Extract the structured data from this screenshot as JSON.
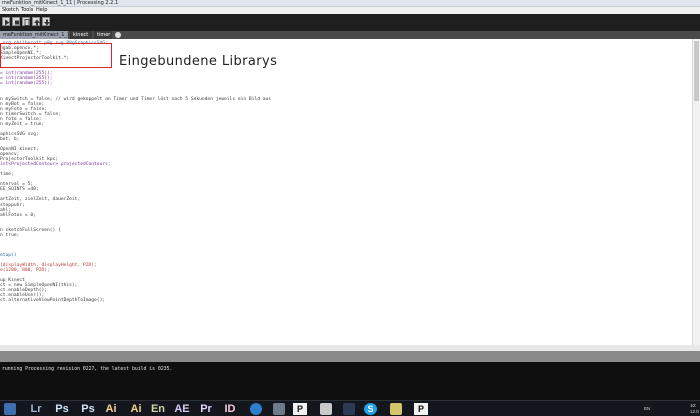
{
  "window": {
    "title": "meFunktion_mitKinect_1_11 | Processing 2.2.1"
  },
  "menu": {
    "items": [
      "Sketch",
      "Tools",
      "Help"
    ]
  },
  "tabs": [
    {
      "label": "meFunktion_mitKinect_1_11",
      "active": true
    },
    {
      "label": "kinect",
      "active": false
    },
    {
      "label": "timer",
      "active": false
    }
  ],
  "annotation": {
    "text": "Eingebundene Librarys"
  },
  "code_lines": [
    ".org.philhosoft.p8g.svg.P8gGraphicsSVG;",
    "ngab.opencv.*;",
    "SimpleOpenNI.*;",
    "KinectProjectorToolkit.*;",
    "",
    "",
    "= int(random(255));",
    "= int(random(255));",
    "= int(random(255));",
    "",
    "",
    "n mySwitch = false; // wird gekoppelt an Timer und Timer löst nach 5 Sekunden jeweils ein Bild aus",
    "n myBot = false;",
    "n myFoto = false;",
    "n timerSwitch = false;",
    "n foto = false;",
    "n myZeit = true;",
    "",
    "aphicsSVG svg;",
    "bot, b;",
    "",
    "OpenNI kinect;",
    "opencv;",
    "ProjectorToolkit kpc;",
    "ist<ProjectedContour> projectedContours;",
    "",
    "time;",
    "",
    "nterval = 5;",
    "EE_SOINTS =40;",
    "",
    "artZeit, zielZeit, dauerZeit;",
    "stoppuhr;",
    "ahl;",
    "ahlFotos = 0;",
    "",
    "",
    "n sketchFullScreen() {",
    "n true;",
    "",
    "",
    "",
    "etup()",
    "",
    "(displayWidth, displayHeight, P2D);",
    "e(1280, 800, P2D);",
    "",
    "up Kinect",
    "ct = new SimpleOpenNI(this);",
    "ct.enableDepth();",
    "ct.enableUser();",
    "ct.alternativeViewPointDepthToImage();",
    ""
  ],
  "console": {
    "message": "running Processing revision 0227, the latest build is 0235."
  },
  "taskbar": {
    "apps": [
      "Lr",
      "Ps",
      "Ps",
      "Ai",
      "Ai",
      "En",
      "AE",
      "Pr",
      "ID",
      "P",
      "S",
      "P"
    ],
    "tray_lang": "EN",
    "clock_time": "10:",
    "clock_date": "12.0"
  },
  "colors": {
    "toolbar_bg": "#1f1f1f",
    "highlight_box": "#d8262c",
    "console_bg": "#0f0f0f",
    "taskbar_bg": "#13161c"
  }
}
